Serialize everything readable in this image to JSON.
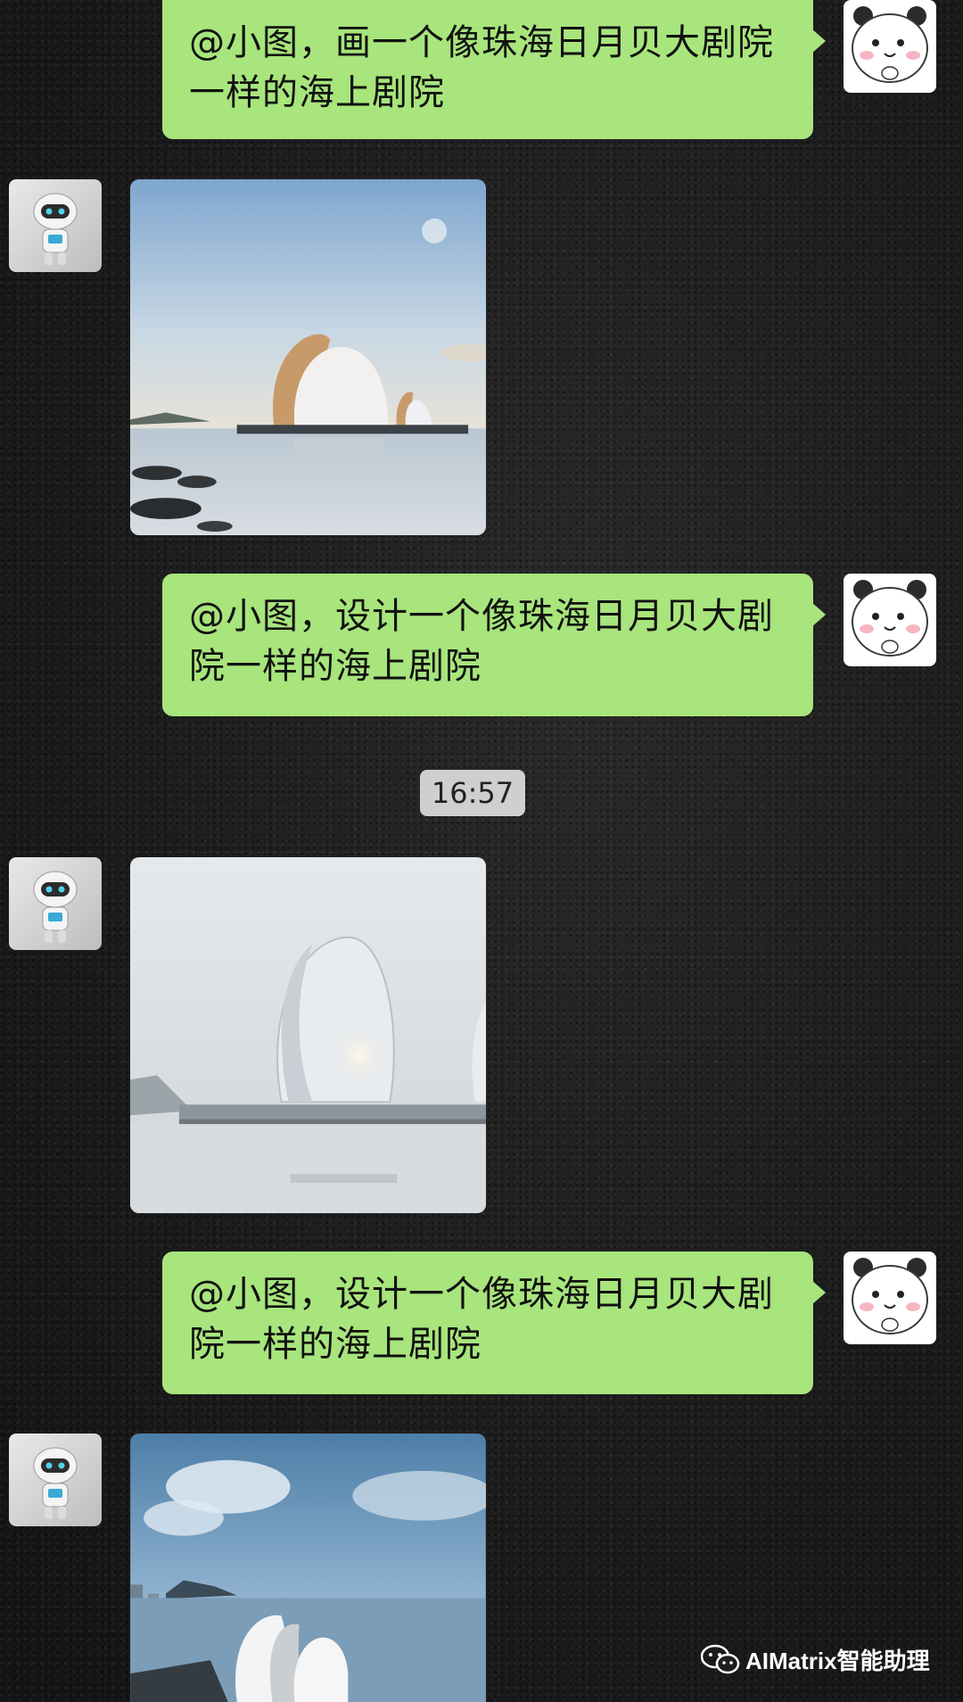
{
  "messages": [
    {
      "type": "outgoing_text",
      "text": "@小图，画一个像珠海日月贝大剧院一样的海上剧院"
    },
    {
      "type": "incoming_image",
      "image": "ai-generated-sea-theatre-image"
    },
    {
      "type": "outgoing_text",
      "text": "@小图，设计一个像珠海日月贝大剧院一样的海上剧院"
    },
    {
      "type": "timestamp",
      "text": "16:57"
    },
    {
      "type": "incoming_image",
      "image": "ai-generated-sea-theatre-image"
    },
    {
      "type": "outgoing_text",
      "text": "@小图，设计一个像珠海日月贝大剧院一样的海上剧院"
    },
    {
      "type": "incoming_image",
      "image": "ai-generated-sea-theatre-image"
    }
  ],
  "avatars": {
    "user": "panda-avatar",
    "bot": "robot-avatar"
  },
  "watermark": {
    "icon": "wechat-icon",
    "text": "AIMatrix智能助理"
  },
  "colors": {
    "outgoing_bubble": "#a8e57c",
    "timestamp_badge": "#cfcfcf"
  }
}
